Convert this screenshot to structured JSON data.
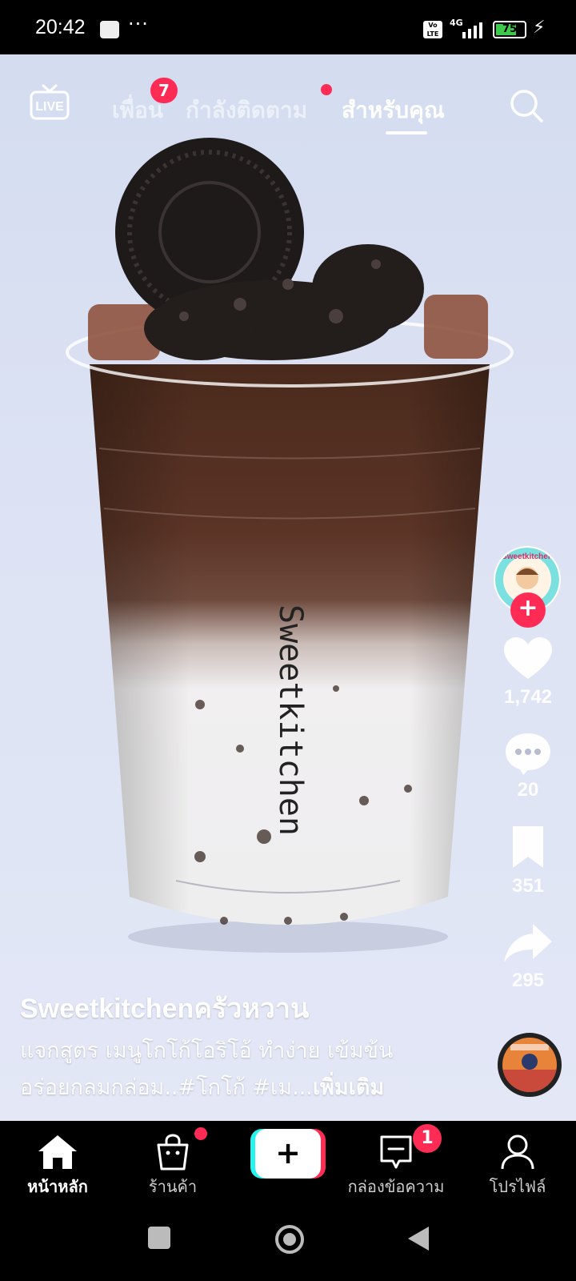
{
  "status_bar": {
    "time": "20:42",
    "dots": "···",
    "volte": "Vo LTE",
    "network": "4G",
    "battery": "75",
    "battery_level": 0.75
  },
  "top_nav": {
    "live_label": "LIVE",
    "tabs": [
      {
        "label": "เพื่อน",
        "badge": "7"
      },
      {
        "label": "กำลังติดตาม",
        "dot": true
      },
      {
        "label": "สำหรับคุณ",
        "active": true
      }
    ]
  },
  "video": {
    "cup_text": "Sweetkitchen",
    "avatar_text": "Sweetkitchen"
  },
  "right_rail": {
    "likes": "1,742",
    "comments": "20",
    "saves": "351",
    "shares": "295"
  },
  "post": {
    "author": "Sweetkitchenครัวหวาน",
    "caption_line1": "แจกสูตร เมนูโกโก้โอริโอ้ ทำง่าย เข้มข้น",
    "caption_line2": "อร่อยกลมกล่อม..#โกโก้ #เม...",
    "more": "เพิ่มเติม"
  },
  "bottom_nav": {
    "home": "หน้าหลัก",
    "shop": "ร้านค้า",
    "create": "+",
    "inbox": "กล่องข้อความ",
    "inbox_badge": "1",
    "profile": "โปรไฟล์"
  },
  "colors": {
    "accent": "#fe2c55",
    "create_cyan": "#25f4ee",
    "create_red": "#fe2c55"
  }
}
